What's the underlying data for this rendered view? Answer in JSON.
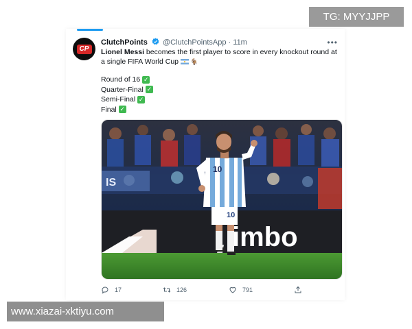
{
  "watermark": {
    "text": "TG: MYYJJPP"
  },
  "site_banner": {
    "text": "www.xiazai-xktiyu.com"
  },
  "tweet": {
    "display_name": "ClutchPoints",
    "handle": "@ClutchPointsApp",
    "separator": "·",
    "time": "11m",
    "avatar_text": "CP",
    "text_mention": "Lionel Messi",
    "text_body": " becomes the first player to score in every knockout round at a single FIFA World Cup",
    "rounds": [
      "Round of 16",
      "Quarter-Final",
      "Semi-Final",
      "Final"
    ],
    "check_icon": "✓",
    "image": {
      "description_icon": "photo",
      "ad_board_text": "imbo",
      "player_number": "10"
    },
    "actions": {
      "reply_count": "17",
      "retweet_count": "126",
      "like_count": "791"
    }
  },
  "colors": {
    "accent": "#1d9bf0",
    "check": "#3fb950",
    "text": "#0f1419",
    "muted": "#536471",
    "pitch": "#3f8a2a"
  }
}
